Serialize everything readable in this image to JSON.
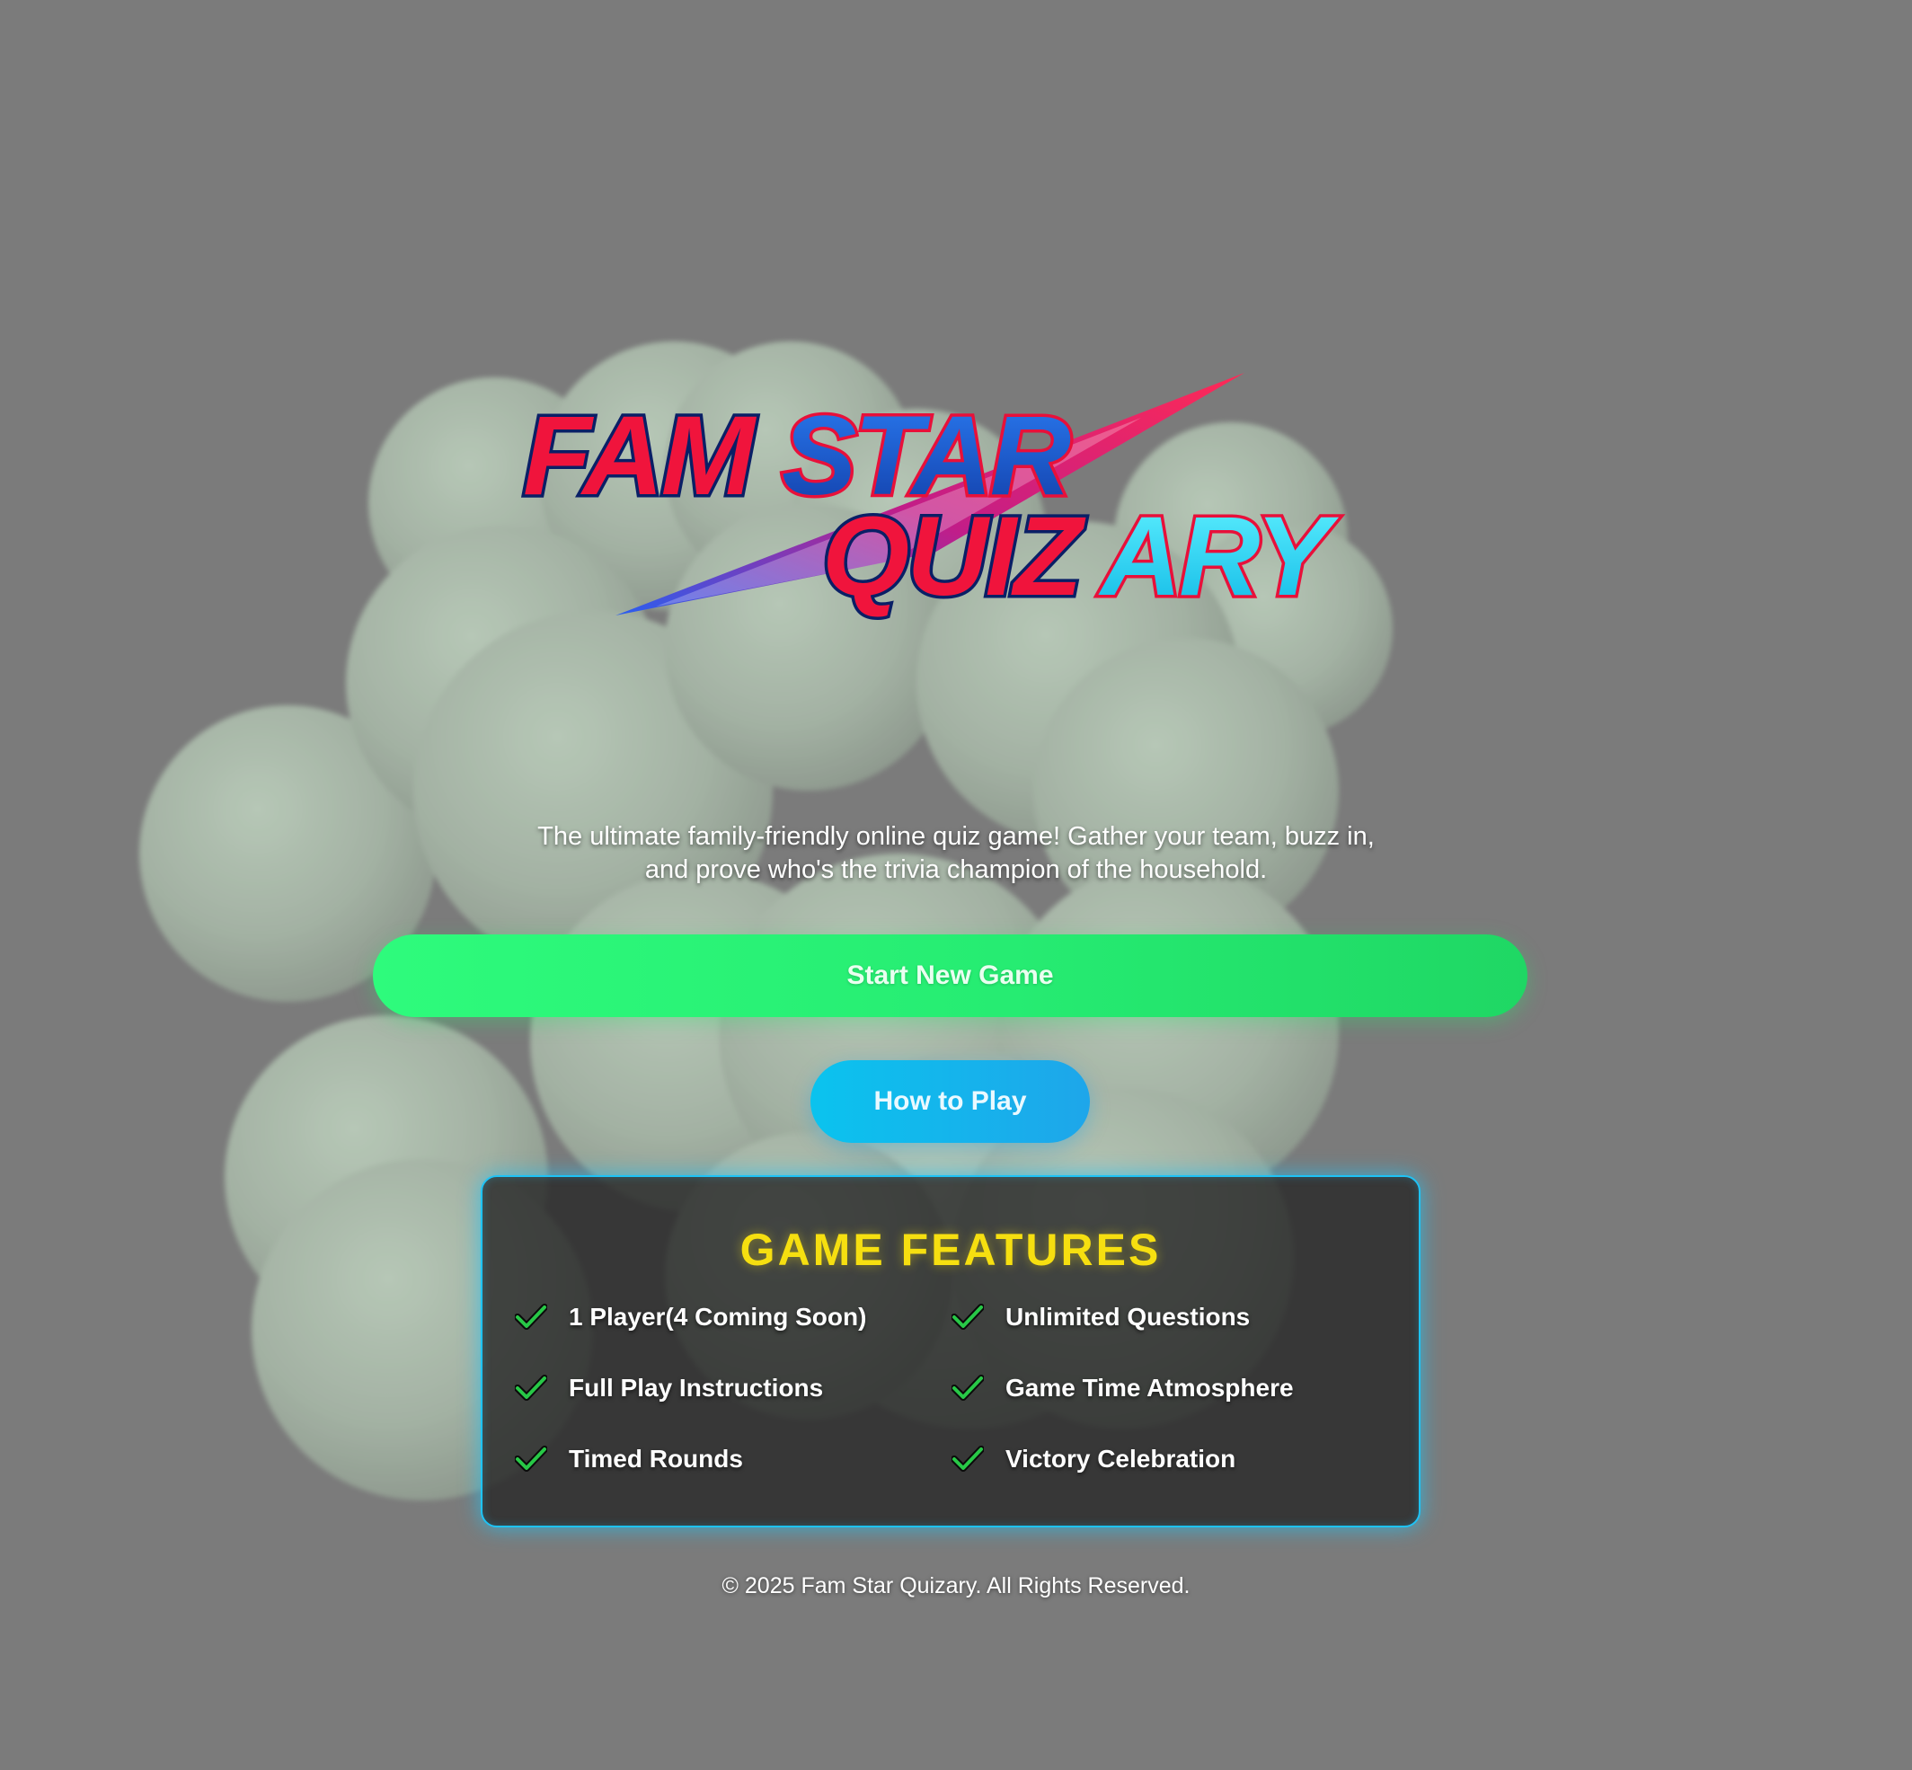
{
  "brand": {
    "logo_line1_part1": "FAM",
    "logo_line1_part2": "STAR",
    "logo_line2_part1": "QUIZ",
    "logo_line2_part2": "ARY"
  },
  "hero": {
    "tagline_line1": "The ultimate family-friendly online quiz game! Gather your team, buzz in,",
    "tagline_line2": "and prove who's the trivia champion of the household."
  },
  "actions": {
    "start_label": "Start New Game",
    "how_label": "How to Play"
  },
  "features": {
    "title": "GAME FEATURES",
    "items": [
      "1 Player(4 Coming Soon)",
      "Unlimited Questions",
      "Full Play Instructions",
      "Game Time Atmosphere",
      "Timed Rounds",
      "Victory Celebration"
    ],
    "icon": "check-icon"
  },
  "footer": {
    "text": "© 2025 Fam Star Quizary. All Rights Reserved."
  },
  "colors": {
    "background": "#7b7b7b",
    "start_button": "#26ec72",
    "how_button": "#0bc3ee",
    "features_border": "#1ec3f6",
    "features_title": "#f6df10",
    "logo_red": "#f0143c",
    "logo_blue": "#1a54d6",
    "logo_cyan": "#19d8f2"
  }
}
